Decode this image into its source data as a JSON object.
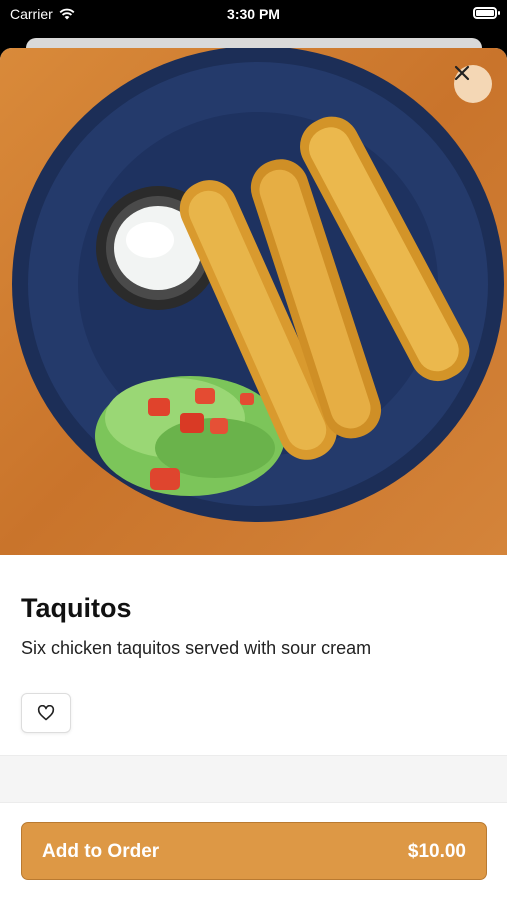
{
  "status_bar": {
    "carrier": "Carrier",
    "time": "3:30 PM"
  },
  "item": {
    "name": "Taquitos",
    "description": "Six chicken taquitos served with sour cream"
  },
  "actions": {
    "close_icon": "close-icon",
    "favorite_icon": "heart-icon",
    "add_to_order_label": "Add to Order",
    "price": "$10.00"
  },
  "colors": {
    "accent": "#dd9845",
    "close_bg": "#f4d7b5"
  }
}
